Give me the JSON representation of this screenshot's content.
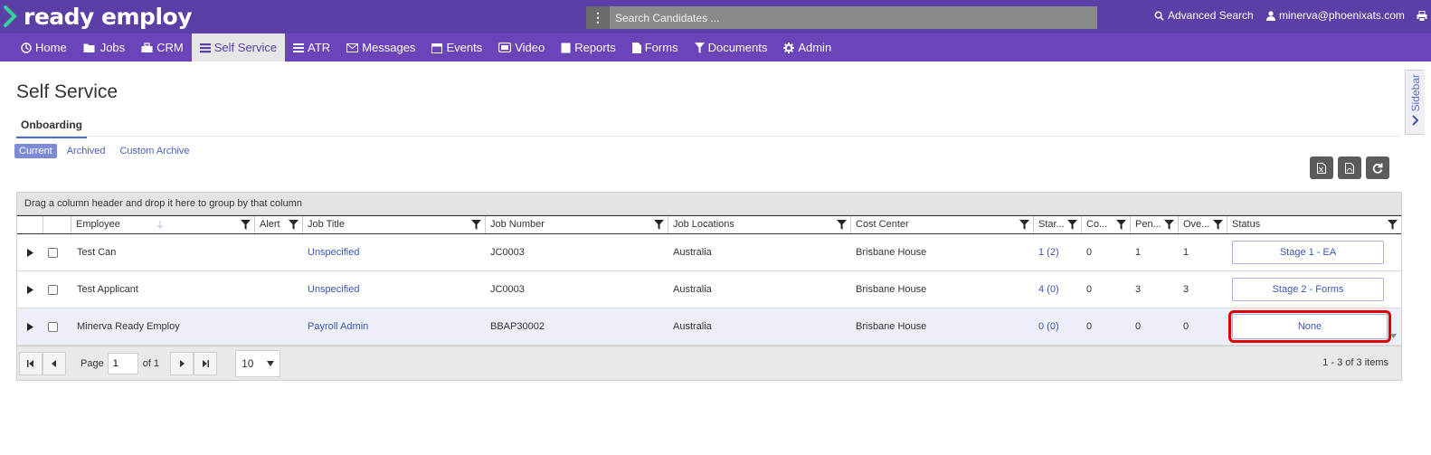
{
  "brand": {
    "name": "ready employ",
    "accent": "#5b3ea6",
    "nav_color": "#6a44b8",
    "highlight": "#e00000"
  },
  "search": {
    "placeholder": "Search Candidates ...",
    "menu_icon": "vertical-dots-icon"
  },
  "header": {
    "advanced_search": "Advanced Search",
    "user_email": "minerva@phoenixats.com"
  },
  "nav": {
    "items": [
      {
        "label": "Home",
        "icon": "home-icon"
      },
      {
        "label": "Jobs",
        "icon": "folder-icon"
      },
      {
        "label": "CRM",
        "icon": "crm-icon"
      },
      {
        "label": "Self Service",
        "icon": "list-icon",
        "active": true
      },
      {
        "label": "ATR",
        "icon": "atr-icon"
      },
      {
        "label": "Messages",
        "icon": "envelope-icon"
      },
      {
        "label": "Events",
        "icon": "calendar-icon"
      },
      {
        "label": "Video",
        "icon": "video-icon"
      },
      {
        "label": "Reports",
        "icon": "report-icon"
      },
      {
        "label": "Forms",
        "icon": "file-icon"
      },
      {
        "label": "Documents",
        "icon": "funnel-icon"
      },
      {
        "label": "Admin",
        "icon": "gear-icon"
      }
    ]
  },
  "page": {
    "title": "Self Service",
    "subtab": "Onboarding",
    "filters": [
      "Current",
      "Archived",
      "Custom Archive"
    ]
  },
  "sidebar": {
    "label": "Sidebar"
  },
  "grid": {
    "group_hint": "Drag a column header and drop it here to group by that column",
    "columns": [
      "Employee",
      "Alert",
      "Job Title",
      "Job Number",
      "Job Locations",
      "Cost Center",
      "Star...",
      "Co...",
      "Pen...",
      "Ove...",
      "Status"
    ],
    "rows": [
      {
        "employee": "Test Can",
        "job_title": "Unspecified",
        "job_number": "JC0003",
        "location": "Australia",
        "cost_center": "Brisbane House",
        "started": "1 (2)",
        "completed": "0",
        "pending": "1",
        "overdue": "1",
        "status": "Stage 1 - EA"
      },
      {
        "employee": "Test Applicant",
        "job_title": "Unspecified",
        "job_number": "JC0003",
        "location": "Australia",
        "cost_center": "Brisbane House",
        "started": "4 (0)",
        "completed": "0",
        "pending": "3",
        "overdue": "3",
        "status": "Stage 2 - Forms"
      },
      {
        "employee": "Minerva Ready Employ",
        "job_title": "Payroll Admin",
        "job_number": "BBAP30002",
        "location": "Australia",
        "cost_center": "Brisbane House",
        "started": "0 (0)",
        "completed": "0",
        "pending": "0",
        "overdue": "0",
        "status": "None",
        "highlighted": true
      }
    ],
    "pager": {
      "page_label": "Page",
      "page_value": "1",
      "of_label": "of 1",
      "page_size": "10",
      "items": "1 - 3 of 3 items"
    }
  }
}
